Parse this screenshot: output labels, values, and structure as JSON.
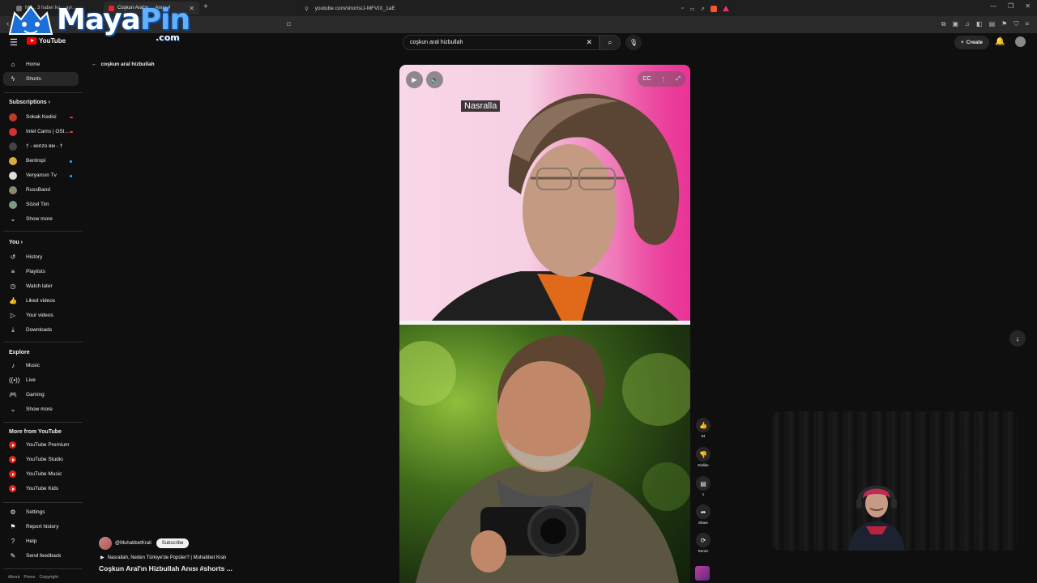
{
  "browser": {
    "tabs": [
      {
        "label": "Mu... 3 haber ko... ayr..."
      },
      {
        "label": "Coşkun Aral'ın ... Anısı #"
      }
    ],
    "url": "youtube.com/shorts/J-MFVtX_1aE"
  },
  "watermark": {
    "brand_main": "Maya",
    "brand_accent": "Pin",
    "brand_suffix": ".com"
  },
  "header": {
    "logo_text": "YouTube",
    "search_value": "coşkun aral hizbullah",
    "create_label": "Create"
  },
  "sidebar": {
    "main": [
      {
        "label": "Home",
        "icon": "home-icon"
      },
      {
        "label": "Shorts",
        "icon": "shorts-icon"
      }
    ],
    "subscriptions_header": "Subscriptions",
    "subscriptions": [
      {
        "label": "Sokak Kedisi",
        "color": "#c0392b"
      },
      {
        "label": "Intel Cams | OSI...",
        "color": "#d63031"
      },
      {
        "label": "† - кепzо вм - †",
        "color": "#444444"
      },
      {
        "label": "Bentropi",
        "color": "#e0a93b"
      },
      {
        "label": "Veryansın Tv",
        "color": "#dddddd"
      },
      {
        "label": "RussBand",
        "color": "#8a8a6a"
      },
      {
        "label": "Sözel Tim",
        "color": "#7a9a8a"
      },
      {
        "label": "Show more",
        "color": ""
      }
    ],
    "you_header": "You",
    "you": [
      {
        "label": "History",
        "icon": "history-icon"
      },
      {
        "label": "Playlists",
        "icon": "playlists-icon"
      },
      {
        "label": "Watch later",
        "icon": "clock-icon"
      },
      {
        "label": "Liked videos",
        "icon": "thumbs-up-icon"
      },
      {
        "label": "Your videos",
        "icon": "play-square-icon"
      },
      {
        "label": "Downloads",
        "icon": "download-icon"
      }
    ],
    "explore_header": "Explore",
    "explore": [
      {
        "label": "Music",
        "icon": "music-icon"
      },
      {
        "label": "Live",
        "icon": "live-icon"
      },
      {
        "label": "Gaming",
        "icon": "gaming-icon"
      },
      {
        "label": "Show more",
        "icon": "chevron-down-icon"
      }
    ],
    "more_header": "More from YouTube",
    "more": [
      {
        "label": "YouTube Premium"
      },
      {
        "label": "YouTube Studio"
      },
      {
        "label": "YouTube Music"
      },
      {
        "label": "YouTube Kids"
      }
    ],
    "settings": [
      {
        "label": "Settings",
        "icon": "gear-icon"
      },
      {
        "label": "Report history",
        "icon": "flag-icon"
      },
      {
        "label": "Help",
        "icon": "help-icon"
      },
      {
        "label": "Send feedback",
        "icon": "feedback-icon"
      }
    ],
    "footer": [
      "About",
      "Press",
      "Copyright"
    ]
  },
  "breadcrumb": {
    "label": "coşkun aral hizbullah"
  },
  "short": {
    "caption": "Nasralla",
    "channel": "@MuhabbetKrali",
    "subscribe_label": "Subscribe",
    "related": "Nasrallah, Neden Türkiye'de Popüler? | Muhabbet Kralı",
    "title": "Coşkun Aral'ın Hizbullah Anısı #shorts ..."
  },
  "actions": {
    "like_count": "64",
    "dislike_label": "Dislike",
    "comment_count": "1",
    "share_label": "Share",
    "remix_label": "Remix"
  }
}
